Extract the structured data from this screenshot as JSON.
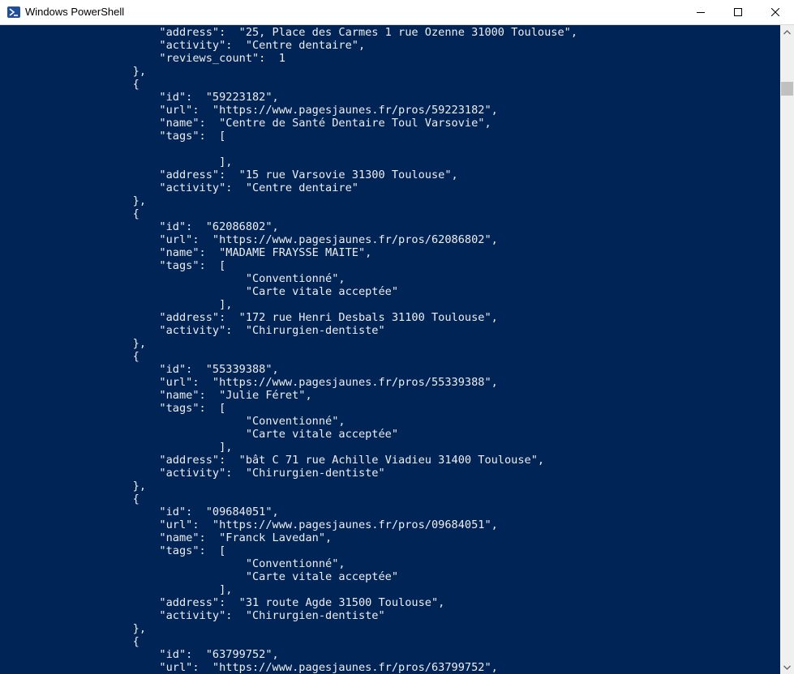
{
  "window": {
    "title": "Windows PowerShell",
    "icon": "powershell-icon",
    "controls": [
      "minimize-icon",
      "maximize-icon",
      "close-icon"
    ]
  },
  "colors": {
    "console_bg": "#012456",
    "console_fg": "#eeedf0",
    "titlebar_bg": "#ffffff",
    "scrollbar_bg": "#f0f0f0",
    "scrollbar_thumb": "#c0c0c0"
  },
  "console": {
    "lines": [
      "                        \"address\":  \"25, Place des Carmes 1 rue Ozenne 31000 Toulouse\",",
      "                        \"activity\":  \"Centre dentaire\",",
      "                        \"reviews_count\":  1",
      "                    },",
      "                    {",
      "                        \"id\":  \"59223182\",",
      "                        \"url\":  \"https://www.pagesjaunes.fr/pros/59223182\",",
      "                        \"name\":  \"Centre de Santé Dentaire Toul Varsovie\",",
      "                        \"tags\":  [",
      "",
      "                                 ],",
      "                        \"address\":  \"15 rue Varsovie 31300 Toulouse\",",
      "                        \"activity\":  \"Centre dentaire\"",
      "                    },",
      "                    {",
      "                        \"id\":  \"62086802\",",
      "                        \"url\":  \"https://www.pagesjaunes.fr/pros/62086802\",",
      "                        \"name\":  \"MADAME FRAYSSE MAITE\",",
      "                        \"tags\":  [",
      "                                     \"Conventionné\",",
      "                                     \"Carte vitale acceptée\"",
      "                                 ],",
      "                        \"address\":  \"172 rue Henri Desbals 31100 Toulouse\",",
      "                        \"activity\":  \"Chirurgien-dentiste\"",
      "                    },",
      "                    {",
      "                        \"id\":  \"55339388\",",
      "                        \"url\":  \"https://www.pagesjaunes.fr/pros/55339388\",",
      "                        \"name\":  \"Julie Féret\",",
      "                        \"tags\":  [",
      "                                     \"Conventionné\",",
      "                                     \"Carte vitale acceptée\"",
      "                                 ],",
      "                        \"address\":  \"bât C 71 rue Achille Viadieu 31400 Toulouse\",",
      "                        \"activity\":  \"Chirurgien-dentiste\"",
      "                    },",
      "                    {",
      "                        \"id\":  \"09684051\",",
      "                        \"url\":  \"https://www.pagesjaunes.fr/pros/09684051\",",
      "                        \"name\":  \"Franck Lavedan\",",
      "                        \"tags\":  [",
      "                                     \"Conventionné\",",
      "                                     \"Carte vitale acceptée\"",
      "                                 ],",
      "                        \"address\":  \"31 route Agde 31500 Toulouse\",",
      "                        \"activity\":  \"Chirurgien-dentiste\"",
      "                    },",
      "                    {",
      "                        \"id\":  \"63799752\",",
      "                        \"url\":  \"https://www.pagesjaunes.fr/pros/63799752\","
    ]
  }
}
